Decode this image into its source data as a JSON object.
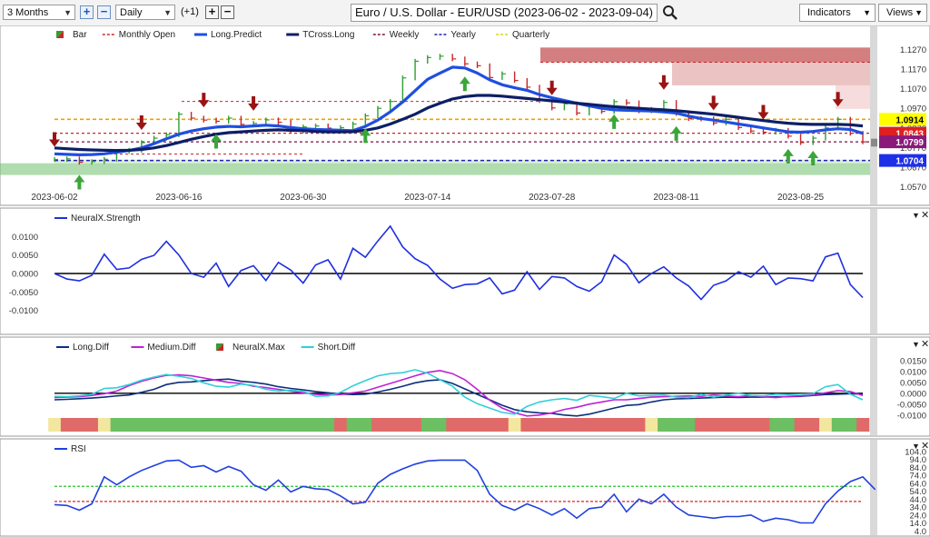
{
  "toolbar": {
    "period": "3 Months",
    "interval": "Daily",
    "offset": "(+1)",
    "title": "Euro / U.S. Dollar - EUR/USD (2023-06-02 - 2023-09-04)",
    "indicators_label": "Indicators",
    "views_label": "Views",
    "plus_icon": "plus-icon",
    "minus_icon": "minus-icon",
    "search_icon": "magnifier-icon"
  },
  "legend_main": [
    {
      "label": "Bar",
      "color": "#2ea02e",
      "style": "bar-swatch"
    },
    {
      "label": "Monthly Open",
      "color": "#c62828",
      "style": "dashed"
    },
    {
      "label": "Long.Predict",
      "color": "#1f4fe0",
      "style": "thick"
    },
    {
      "label": "TCross.Long",
      "color": "#0c1f66",
      "style": "thick"
    },
    {
      "label": "Weekly",
      "color": "#7a1040",
      "style": "dashed"
    },
    {
      "label": "Yearly",
      "color": "#1f1fb0",
      "style": "dashed"
    },
    {
      "label": "Quarterly",
      "color": "#d8d820",
      "style": "dashed"
    }
  ],
  "price_labels": [
    {
      "text": "1.0914",
      "value": 1.0914,
      "bg": "#ffff00",
      "fg": "#000000"
    },
    {
      "text": "1.0843",
      "value": 1.0843,
      "bg": "#e02020",
      "fg": "#ffffff"
    },
    {
      "text": "1.0799",
      "value": 1.0799,
      "bg": "#8a1a7a",
      "fg": "#ffffff"
    },
    {
      "text": "1.0704",
      "value": 1.0704,
      "bg": "#1f2fe8",
      "fg": "#ffffff"
    }
  ],
  "chart_data": [
    {
      "type": "line",
      "name": "price",
      "x_labels": [
        "2023-06-02",
        "2023-06-16",
        "2023-06-30",
        "2023-07-14",
        "2023-07-28",
        "2023-08-11",
        "2023-08-25"
      ],
      "y_ticks": [
        "1.1270",
        "1.1170",
        "1.1070",
        "1.0970",
        "1.0870",
        "1.0770",
        "1.0670",
        "1.0570"
      ],
      "ylim": [
        1.054,
        1.13
      ],
      "x": [
        "2023-06-02",
        "2023-06-05",
        "2023-06-06",
        "2023-06-07",
        "2023-06-08",
        "2023-06-09",
        "2023-06-12",
        "2023-06-13",
        "2023-06-14",
        "2023-06-15",
        "2023-06-16",
        "2023-06-19",
        "2023-06-20",
        "2023-06-21",
        "2023-06-22",
        "2023-06-23",
        "2023-06-26",
        "2023-06-27",
        "2023-06-28",
        "2023-06-29",
        "2023-06-30",
        "2023-07-03",
        "2023-07-04",
        "2023-07-05",
        "2023-07-06",
        "2023-07-07",
        "2023-07-10",
        "2023-07-11",
        "2023-07-12",
        "2023-07-13",
        "2023-07-14",
        "2023-07-17",
        "2023-07-18",
        "2023-07-19",
        "2023-07-20",
        "2023-07-21",
        "2023-07-24",
        "2023-07-25",
        "2023-07-26",
        "2023-07-27",
        "2023-07-28",
        "2023-07-31",
        "2023-08-01",
        "2023-08-02",
        "2023-08-03",
        "2023-08-04",
        "2023-08-07",
        "2023-08-08",
        "2023-08-09",
        "2023-08-10",
        "2023-08-11",
        "2023-08-14",
        "2023-08-15",
        "2023-08-16",
        "2023-08-17",
        "2023-08-18",
        "2023-08-21",
        "2023-08-22",
        "2023-08-23",
        "2023-08-24",
        "2023-08-25",
        "2023-08-28",
        "2023-08-29",
        "2023-08-30",
        "2023-08-31",
        "2023-09-01"
      ],
      "series": [
        {
          "name": "Long.Predict",
          "color": "#1f4fe0",
          "values": [
            1.0738,
            1.0735,
            1.0733,
            1.0734,
            1.0738,
            1.0746,
            1.0755,
            1.0768,
            1.079,
            1.0815,
            1.0838,
            1.0854,
            1.0866,
            1.0874,
            1.0878,
            1.0876,
            1.088,
            1.0884,
            1.088,
            1.0872,
            1.0866,
            1.0862,
            1.086,
            1.0858,
            1.0856,
            1.0878,
            1.091,
            1.0952,
            1.1002,
            1.106,
            1.1118,
            1.115,
            1.118,
            1.1176,
            1.115,
            1.1115,
            1.109,
            1.1075,
            1.1062,
            1.104,
            1.1024,
            1.101,
            1.0996,
            1.0982,
            1.097,
            1.0962,
            1.096,
            1.0958,
            1.0956,
            1.0952,
            1.0946,
            1.093,
            1.0918,
            1.091,
            1.09,
            1.089,
            1.088,
            1.087,
            1.086,
            1.085,
            1.0848,
            1.0852,
            1.086,
            1.0866,
            1.0862,
            1.0842
          ]
        },
        {
          "name": "TCross.Long",
          "color": "#0c1f66",
          "values": [
            1.0768,
            1.0764,
            1.076,
            1.0758,
            1.0756,
            1.0755,
            1.0756,
            1.076,
            1.0768,
            1.078,
            1.0796,
            1.0812,
            1.0826,
            1.0838,
            1.0846,
            1.085,
            1.0854,
            1.0858,
            1.086,
            1.0858,
            1.0856,
            1.0852,
            1.085,
            1.085,
            1.0851,
            1.0858,
            1.087,
            1.089,
            1.0914,
            1.094,
            1.0972,
            1.0996,
            1.1018,
            1.103,
            1.1036,
            1.1036,
            1.1032,
            1.1026,
            1.102,
            1.1014,
            1.1008,
            1.1002,
            1.0996,
            1.099,
            1.0984,
            1.0978,
            1.0974,
            1.097,
            1.0966,
            1.0962,
            1.0958,
            1.0952,
            1.0946,
            1.094,
            1.0932,
            1.0924,
            1.0916,
            1.0908,
            1.09,
            1.0894,
            1.089,
            1.0888,
            1.0888,
            1.0888,
            1.0886,
            1.088
          ]
        }
      ],
      "close": [
        1.0709,
        1.0712,
        1.0695,
        1.0698,
        1.071,
        1.075,
        1.0756,
        1.0795,
        1.0818,
        1.0835,
        1.094,
        1.092,
        1.091,
        1.0904,
        1.092,
        1.0888,
        1.0893,
        1.0911,
        1.0899,
        1.0854,
        1.0875,
        1.088,
        1.0869,
        1.0871,
        1.089,
        1.0932,
        1.097,
        1.1005,
        1.1125,
        1.121,
        1.1229,
        1.1236,
        1.1222,
        1.1197,
        1.1187,
        1.1127,
        1.1146,
        1.1112,
        1.1078,
        1.101,
        1.0972,
        1.0993,
        1.0946,
        1.098,
        1.0954,
        1.1004,
        1.0998,
        1.0957,
        1.0965,
        1.1,
        1.0944,
        1.0918,
        1.0916,
        1.0895,
        1.0914,
        1.0872,
        1.0854,
        1.0848,
        1.0858,
        1.0828,
        1.0795,
        1.0818,
        1.087,
        1.0914,
        1.0843,
        1.0799
      ],
      "arrows_down": [
        0,
        7,
        12,
        16,
        40,
        49,
        53,
        57,
        63
      ],
      "arrows_up": [
        2,
        13,
        25,
        33,
        45,
        50,
        59,
        61
      ]
    },
    {
      "type": "line",
      "name": "NeuralX.Strength",
      "y_ticks": [
        "0.0100",
        "0.0050",
        "0.0000",
        "-0.0050",
        "-0.0100"
      ],
      "ylim": [
        -0.014,
        0.014
      ],
      "series": [
        {
          "name": "NeuralX.Strength",
          "color": "#1f2fe0",
          "values": [
            0.0,
            -0.0015,
            -0.002,
            -0.0005,
            0.0052,
            0.0011,
            0.0015,
            0.0038,
            0.0049,
            0.0087,
            0.005,
            0.0,
            -0.001,
            0.0028,
            -0.0035,
            0.0008,
            0.0021,
            -0.0019,
            0.003,
            0.0009,
            -0.0026,
            0.0023,
            0.0037,
            -0.0015,
            0.0068,
            0.0044,
            0.0088,
            0.0128,
            0.0072,
            0.004,
            0.0022,
            -0.0015,
            -0.004,
            -0.003,
            -0.0028,
            -0.0012,
            -0.0055,
            -0.0045,
            0.0005,
            -0.0043,
            -0.0008,
            -0.0012,
            -0.0035,
            -0.0048,
            -0.0022,
            0.005,
            0.0025,
            -0.0025,
            0.0,
            0.0018,
            -0.0012,
            -0.0034,
            -0.007,
            -0.0032,
            -0.002,
            0.0005,
            -0.001,
            0.002,
            -0.003,
            -0.0012,
            -0.0014,
            -0.002,
            0.0045,
            0.0055,
            -0.003,
            -0.0065
          ]
        }
      ]
    },
    {
      "type": "line",
      "name": "diff",
      "y_ticks": [
        "0.0150",
        "0.0100",
        "0.0050",
        "0.0000",
        "-0.0050",
        "-0.0100"
      ],
      "ylim": [
        -0.013,
        0.0195
      ],
      "series": [
        {
          "name": "Long.Diff",
          "color": "#0c2f7a",
          "values": [
            -0.003,
            -0.0028,
            -0.0025,
            -0.0022,
            -0.0018,
            -0.0012,
            -0.0008,
            0.0004,
            0.0018,
            0.004,
            0.005,
            0.0052,
            0.0058,
            0.0062,
            0.0065,
            0.0055,
            0.005,
            0.0042,
            0.003,
            0.0022,
            0.0016,
            0.0008,
            0.0002,
            -0.0004,
            -0.0006,
            -0.0004,
            0.0006,
            0.0018,
            0.0032,
            0.0048,
            0.0058,
            0.0062,
            0.0045,
            0.002,
            -0.0005,
            -0.003,
            -0.0055,
            -0.0075,
            -0.0085,
            -0.009,
            -0.0092,
            -0.01,
            -0.0104,
            -0.0096,
            -0.0082,
            -0.0068,
            -0.0056,
            -0.0052,
            -0.004,
            -0.003,
            -0.0026,
            -0.0024,
            -0.0022,
            -0.002,
            -0.0018,
            -0.0019,
            -0.0018,
            -0.0018,
            -0.0016,
            -0.0016,
            -0.0014,
            -0.001,
            -0.0006,
            -0.0004,
            -0.0002,
            -0.0004
          ]
        },
        {
          "name": "Medium.Diff",
          "color": "#c020d8",
          "values": [
            -0.002,
            -0.0018,
            -0.0016,
            -0.001,
            -0.0002,
            0.001,
            0.0035,
            0.0055,
            0.007,
            0.0082,
            0.0084,
            0.008,
            0.007,
            0.006,
            0.005,
            0.0045,
            0.0032,
            0.0026,
            0.0018,
            0.001,
            0.0002,
            -0.0005,
            -0.0008,
            -0.0006,
            0.0002,
            0.001,
            0.0028,
            0.0045,
            0.0062,
            0.008,
            0.0096,
            0.0104,
            0.009,
            0.0062,
            0.0018,
            -0.0032,
            -0.0068,
            -0.009,
            -0.0104,
            -0.01,
            -0.009,
            -0.0074,
            -0.0064,
            -0.005,
            -0.004,
            -0.003,
            -0.003,
            -0.0024,
            -0.0018,
            -0.0016,
            -0.0014,
            -0.0012,
            -0.0014,
            -0.0008,
            -0.0012,
            -0.0016,
            -0.001,
            -0.0016,
            -0.002,
            -0.0014,
            -0.0012,
            -0.0008,
            0.0002,
            0.0012,
            0.0008,
            -0.001
          ]
        },
        {
          "name": "Short.Diff",
          "color": "#30d0d8",
          "values": [
            -0.0014,
            -0.0016,
            -0.0012,
            -0.0004,
            0.0022,
            0.0025,
            0.004,
            0.006,
            0.0074,
            0.0086,
            0.0078,
            0.0068,
            0.0048,
            0.0032,
            0.0028,
            0.0042,
            0.0036,
            0.0018,
            0.001,
            0.0014,
            0.001,
            -0.0014,
            -0.0012,
            0.0004,
            0.0034,
            0.0058,
            0.008,
            0.009,
            0.0094,
            0.0108,
            0.0092,
            0.0062,
            0.0032,
            -0.0018,
            -0.0048,
            -0.0068,
            -0.0088,
            -0.0096,
            -0.006,
            -0.004,
            -0.003,
            -0.0024,
            -0.0032,
            -0.001,
            -0.0016,
            -0.0024,
            0.0,
            -0.0012,
            -0.001,
            -0.0008,
            -0.0018,
            -0.002,
            -0.0004,
            -0.0018,
            -0.0008,
            0.0,
            -0.001,
            -0.0012,
            -0.0004,
            -0.0006,
            -0.0004,
            -0.0002,
            0.003,
            0.004,
            -0.0004,
            -0.003
          ]
        }
      ],
      "max_colors": [
        "Y",
        "R",
        "R",
        "R",
        "Y",
        "G",
        "G",
        "G",
        "G",
        "G",
        "G",
        "G",
        "G",
        "G",
        "G",
        "G",
        "G",
        "G",
        "G",
        "G",
        "G",
        "G",
        "G",
        "R",
        "G",
        "G",
        "R",
        "R",
        "R",
        "R",
        "G",
        "G",
        "R",
        "R",
        "R",
        "R",
        "R",
        "Y",
        "R",
        "R",
        "R",
        "R",
        "R",
        "R",
        "R",
        "R",
        "R",
        "R",
        "Y",
        "G",
        "G",
        "G",
        "R",
        "R",
        "R",
        "R",
        "R",
        "R",
        "G",
        "G",
        "R",
        "R",
        "Y",
        "G",
        "G",
        "R"
      ]
    },
    {
      "type": "line",
      "name": "RSI",
      "y_ticks": [
        "104.0",
        "94.0",
        "84.0",
        "74.0",
        "64.0",
        "54.0",
        "44.0",
        "34.0",
        "24.0",
        "14.0",
        "4.0"
      ],
      "ylim": [
        2,
        106
      ],
      "ref_lines": [
        {
          "value": 60,
          "color": "#2ac02a"
        },
        {
          "value": 41,
          "color": "#e02020"
        }
      ],
      "series": [
        {
          "name": "RSI",
          "color": "#1f40e0",
          "values": [
            37,
            36,
            30,
            38,
            72,
            62,
            72,
            80,
            86,
            92,
            93,
            84,
            86,
            78,
            85,
            79,
            62,
            55,
            68,
            53,
            60,
            57,
            56,
            48,
            38,
            40,
            64,
            75,
            82,
            88,
            92,
            93,
            93,
            93,
            80,
            50,
            36,
            30,
            38,
            32,
            24,
            32,
            20,
            32,
            34,
            50,
            28,
            44,
            38,
            50,
            34,
            24,
            22,
            20,
            22,
            22,
            24,
            16,
            20,
            18,
            14,
            14,
            38,
            54,
            66,
            72,
            56
          ]
        }
      ]
    }
  ],
  "panels": [
    {
      "name": "NeuralX.Strength"
    },
    {
      "legend": [
        {
          "label": "Long.Diff",
          "color": "#0c2f7a"
        },
        {
          "label": "Medium.Diff",
          "color": "#c020d8"
        },
        {
          "label": "NeuralX.Max",
          "color": "#2ea02e"
        },
        {
          "label": "Short.Diff",
          "color": "#30d0d8"
        }
      ]
    },
    {
      "name": "RSI"
    }
  ]
}
